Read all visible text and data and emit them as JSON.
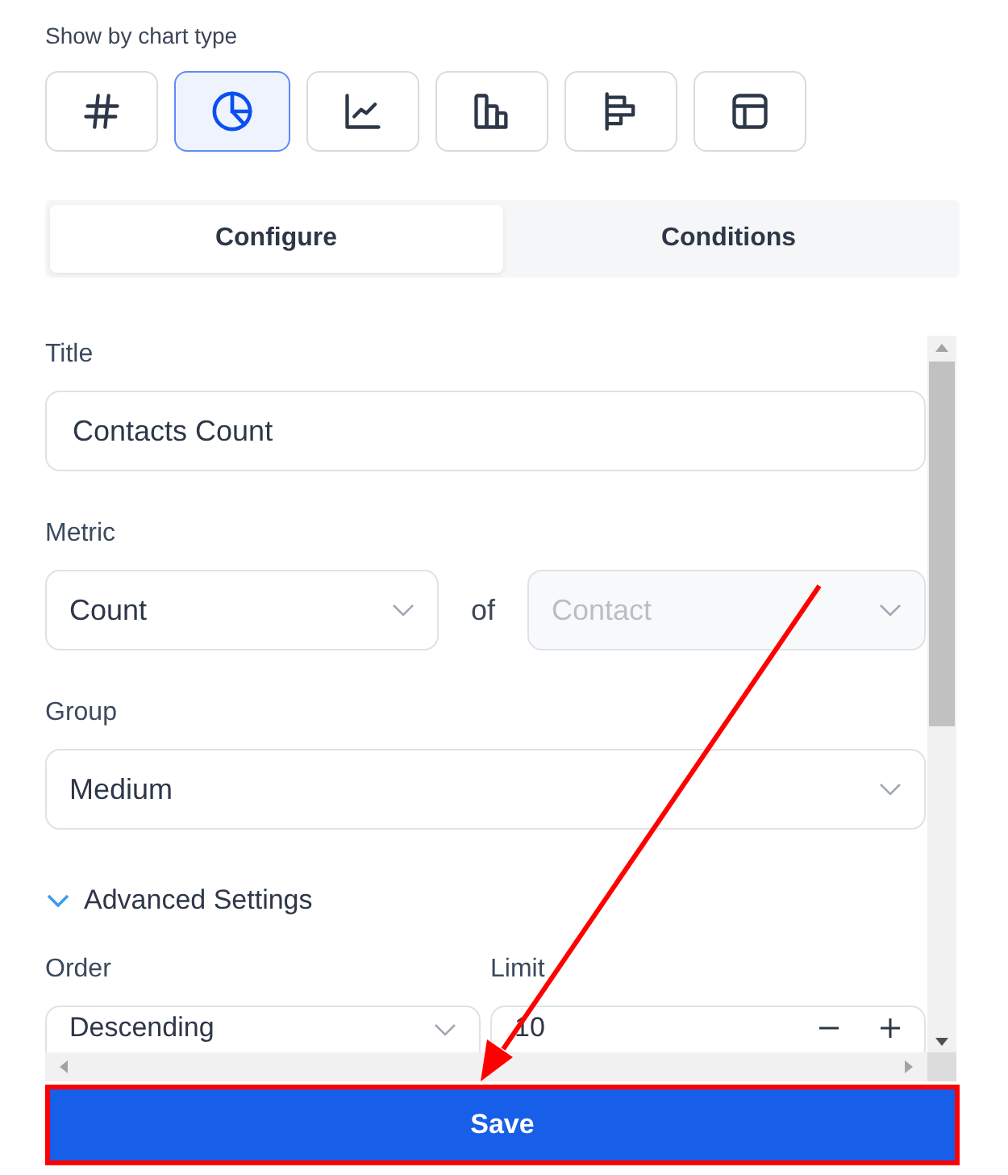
{
  "section_label": "Show by chart type",
  "chart_types": [
    {
      "kind": "number",
      "selected": false
    },
    {
      "kind": "pie",
      "selected": true
    },
    {
      "kind": "line",
      "selected": false
    },
    {
      "kind": "column",
      "selected": false
    },
    {
      "kind": "bar",
      "selected": false
    },
    {
      "kind": "table",
      "selected": false
    }
  ],
  "tabs": [
    {
      "label": "Configure",
      "selected": true
    },
    {
      "label": "Conditions",
      "selected": false
    }
  ],
  "form": {
    "title": {
      "label": "Title",
      "value": "Contacts Count"
    },
    "metric": {
      "label": "Metric",
      "aggregate": "Count",
      "connector": "of",
      "object": {
        "value": "Contact",
        "disabled": true
      }
    },
    "group": {
      "label": "Group",
      "value": "Medium"
    },
    "advanced": {
      "label": "Advanced Settings",
      "expanded": true
    },
    "order": {
      "label": "Order",
      "value": "Descending"
    },
    "limit": {
      "label": "Limit",
      "value": "10"
    }
  },
  "save_button": "Save"
}
